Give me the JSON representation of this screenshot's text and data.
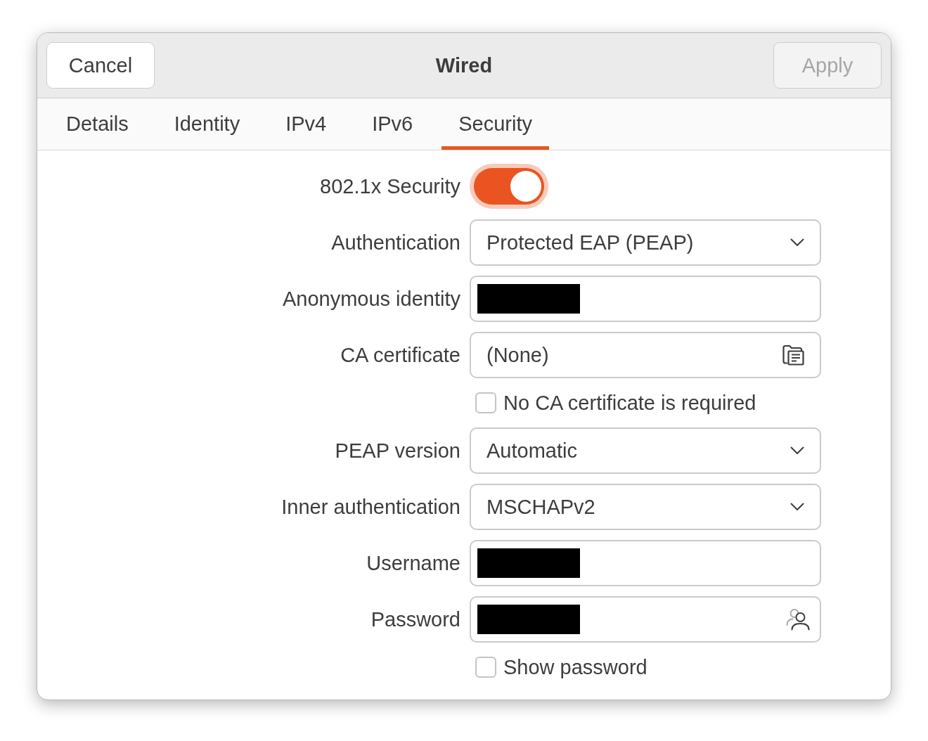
{
  "header": {
    "title": "Wired",
    "cancel_button": {
      "label": "Cancel",
      "disabled": false
    },
    "apply_button": {
      "label": "Apply",
      "disabled": true
    }
  },
  "tabs": [
    {
      "label": "Details",
      "selected": false
    },
    {
      "label": "Identity",
      "selected": false
    },
    {
      "label": "IPv4",
      "selected": false
    },
    {
      "label": "IPv6",
      "selected": false
    },
    {
      "label": "Security",
      "selected": true
    }
  ],
  "form": {
    "rows": [
      {
        "kind": "switch",
        "label": "802.1x Security",
        "on": true,
        "focused": true
      },
      {
        "kind": "dropdown",
        "label": "Authentication",
        "value": "Protected EAP (PEAP)"
      },
      {
        "kind": "entry",
        "label": "Anonymous identity",
        "redacted": true
      },
      {
        "kind": "file",
        "label": "CA certificate",
        "value": "(None)"
      },
      {
        "kind": "checkbox",
        "label": "No CA certificate is required",
        "checked": false
      },
      {
        "kind": "dropdown",
        "label": "PEAP version",
        "value": "Automatic"
      },
      {
        "kind": "dropdown",
        "label": "Inner authentication",
        "value": "MSCHAPv2"
      },
      {
        "kind": "entry",
        "label": "Username",
        "redacted": true
      },
      {
        "kind": "password",
        "label": "Password",
        "redacted": true
      },
      {
        "kind": "checkbox",
        "label": "Show password",
        "checked": false
      }
    ]
  }
}
